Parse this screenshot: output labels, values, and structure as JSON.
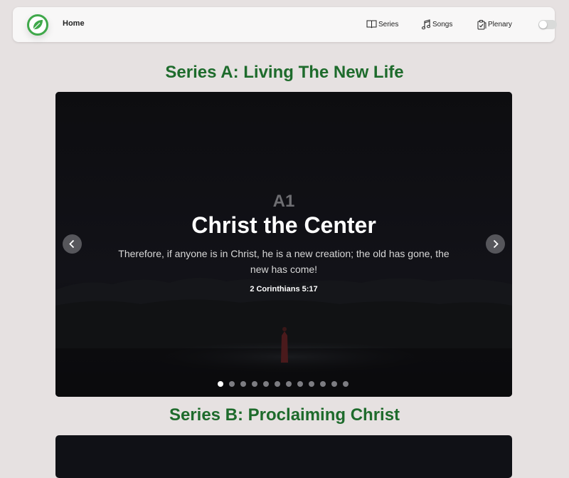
{
  "nav": {
    "home_label": "Home",
    "items": [
      {
        "label": "Series",
        "icon": "book-icon"
      },
      {
        "label": "Songs",
        "icon": "music-note-icon"
      },
      {
        "label": "Plenary",
        "icon": "clipboard-check-icon"
      }
    ],
    "theme_toggle": {
      "state": "off"
    }
  },
  "sections": [
    {
      "title": "Series A: Living The New Life",
      "slide": {
        "code": "A1",
        "title": "Christ the Center",
        "text": "Therefore, if anyone is in Christ, he is a new creation; the old has gone, the new has come!",
        "reference": "2 Corinthians 5:17"
      },
      "slide_count": 12,
      "active_slide": 1
    },
    {
      "title": "Series B: Proclaiming Christ"
    }
  ],
  "colors": {
    "accent": "#1e6b2c",
    "logo_green": "#3fa84a",
    "background": "#e6e1e1"
  }
}
